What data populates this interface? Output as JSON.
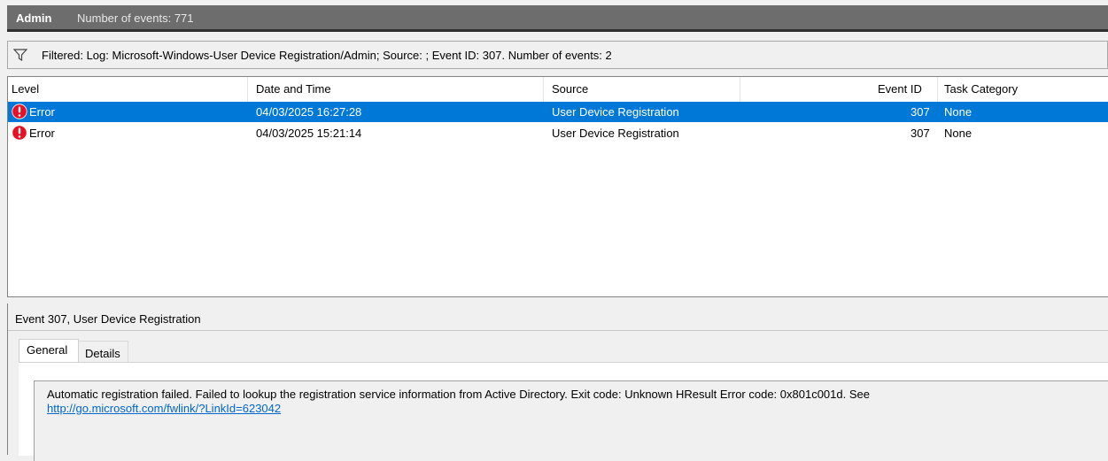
{
  "header": {
    "title": "Admin",
    "event_count": "Number of events: 771"
  },
  "filter": {
    "icon": "filter-icon",
    "text": "Filtered: Log: Microsoft-Windows-User Device Registration/Admin; Source: ; Event ID: 307. Number of events: 2"
  },
  "list": {
    "columns": {
      "level": "Level",
      "date_time": "Date and Time",
      "source": "Source",
      "event_id": "Event ID",
      "task_category": "Task Category"
    },
    "rows": [
      {
        "level": "Error",
        "date_time": "04/03/2025 16:27:28",
        "source": "User Device Registration",
        "event_id": "307",
        "task_category": "None",
        "selected": true,
        "icon": "error-icon"
      },
      {
        "level": "Error",
        "date_time": "04/03/2025 15:21:14",
        "source": "User Device Registration",
        "event_id": "307",
        "task_category": "None",
        "selected": false,
        "icon": "error-icon"
      }
    ]
  },
  "detail": {
    "title": "Event 307, User Device Registration",
    "tabs": {
      "general": "General",
      "details": "Details"
    },
    "message": "Automatic registration failed. Failed to lookup the registration service information from Active Directory. Exit code: Unknown HResult Error code: 0x801c001d. See",
    "link": "http://go.microsoft.com/fwlink/?LinkId=623042"
  },
  "colors": {
    "selection": "#0078d7",
    "error_red": "#e81123",
    "header_bg": "#6d6d6d",
    "link": "#0066cc"
  }
}
